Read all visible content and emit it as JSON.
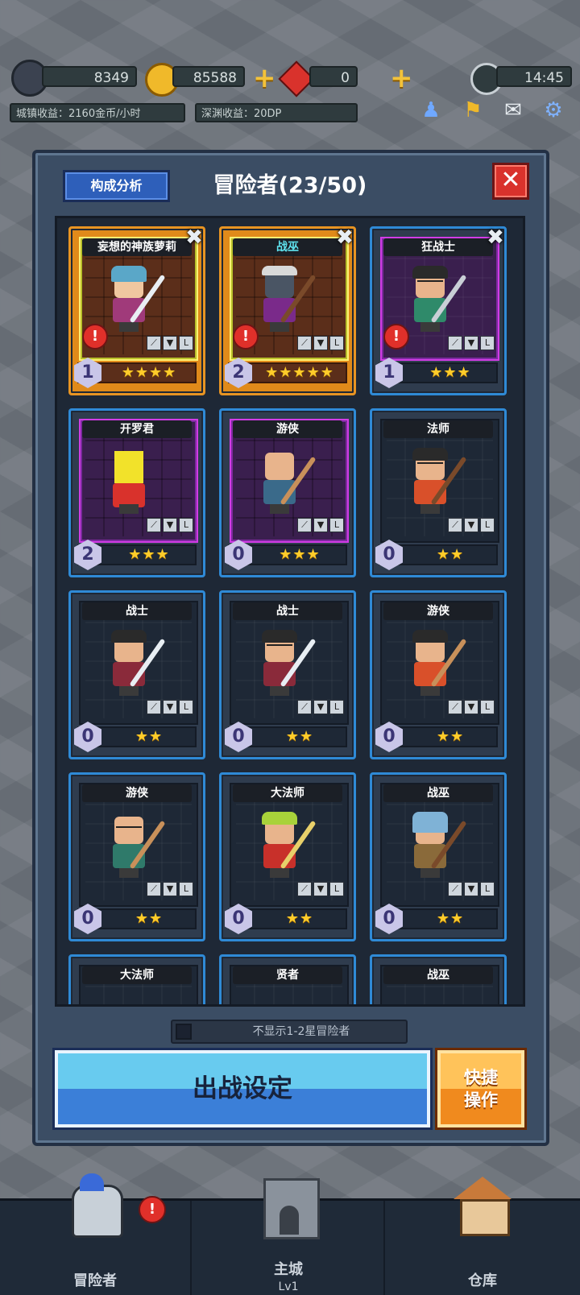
{
  "hud": {
    "dp_value": "8349",
    "gold_value": "85588",
    "gem_value": "0",
    "time": "14:45",
    "town_income": "城镇收益：2160金币/小时",
    "abyss_income": "深渊收益：20DP"
  },
  "panel": {
    "analysis_label": "构成分析",
    "title": "冒险者(23/50)",
    "close_label": "✕"
  },
  "cards": [
    {
      "name": "妄想的神族萝莉",
      "level": "1",
      "stars": "★★★★",
      "alert": "!"
    },
    {
      "name": "战巫",
      "level": "2",
      "stars": "★★★★★",
      "alert": "!"
    },
    {
      "name": "狂战士",
      "level": "1",
      "stars": "★★★",
      "alert": "!"
    },
    {
      "name": "开罗君",
      "level": "2",
      "stars": "★★★"
    },
    {
      "name": "游侠",
      "level": "0",
      "stars": "★★★"
    },
    {
      "name": "法师",
      "level": "0",
      "stars": "★★"
    },
    {
      "name": "战士",
      "level": "0",
      "stars": "★★"
    },
    {
      "name": "战士",
      "level": "0",
      "stars": "★★"
    },
    {
      "name": "游侠",
      "level": "0",
      "stars": "★★"
    },
    {
      "name": "游侠",
      "level": "0",
      "stars": "★★"
    },
    {
      "name": "大法师",
      "level": "0",
      "stars": "★★"
    },
    {
      "name": "战巫",
      "level": "0",
      "stars": "★★"
    },
    {
      "name": "大法师"
    },
    {
      "name": "贤者"
    },
    {
      "name": "战巫"
    }
  ],
  "filter_label": "不显示1-2星冒险者",
  "battle_button": "出战设定",
  "quick_button": "快捷\n操作",
  "quick_button_line1": "快捷",
  "quick_button_line2": "操作",
  "nav": {
    "adventurer": "冒险者",
    "castle": "主城",
    "castle_level": "Lv1",
    "warehouse": "仓库",
    "alert": "!"
  },
  "colors": {
    "gold_frame": "#e89422",
    "blue_frame": "#2f8ad6",
    "purple_frame": "#d23ce6",
    "star": "#ffcc2a"
  }
}
